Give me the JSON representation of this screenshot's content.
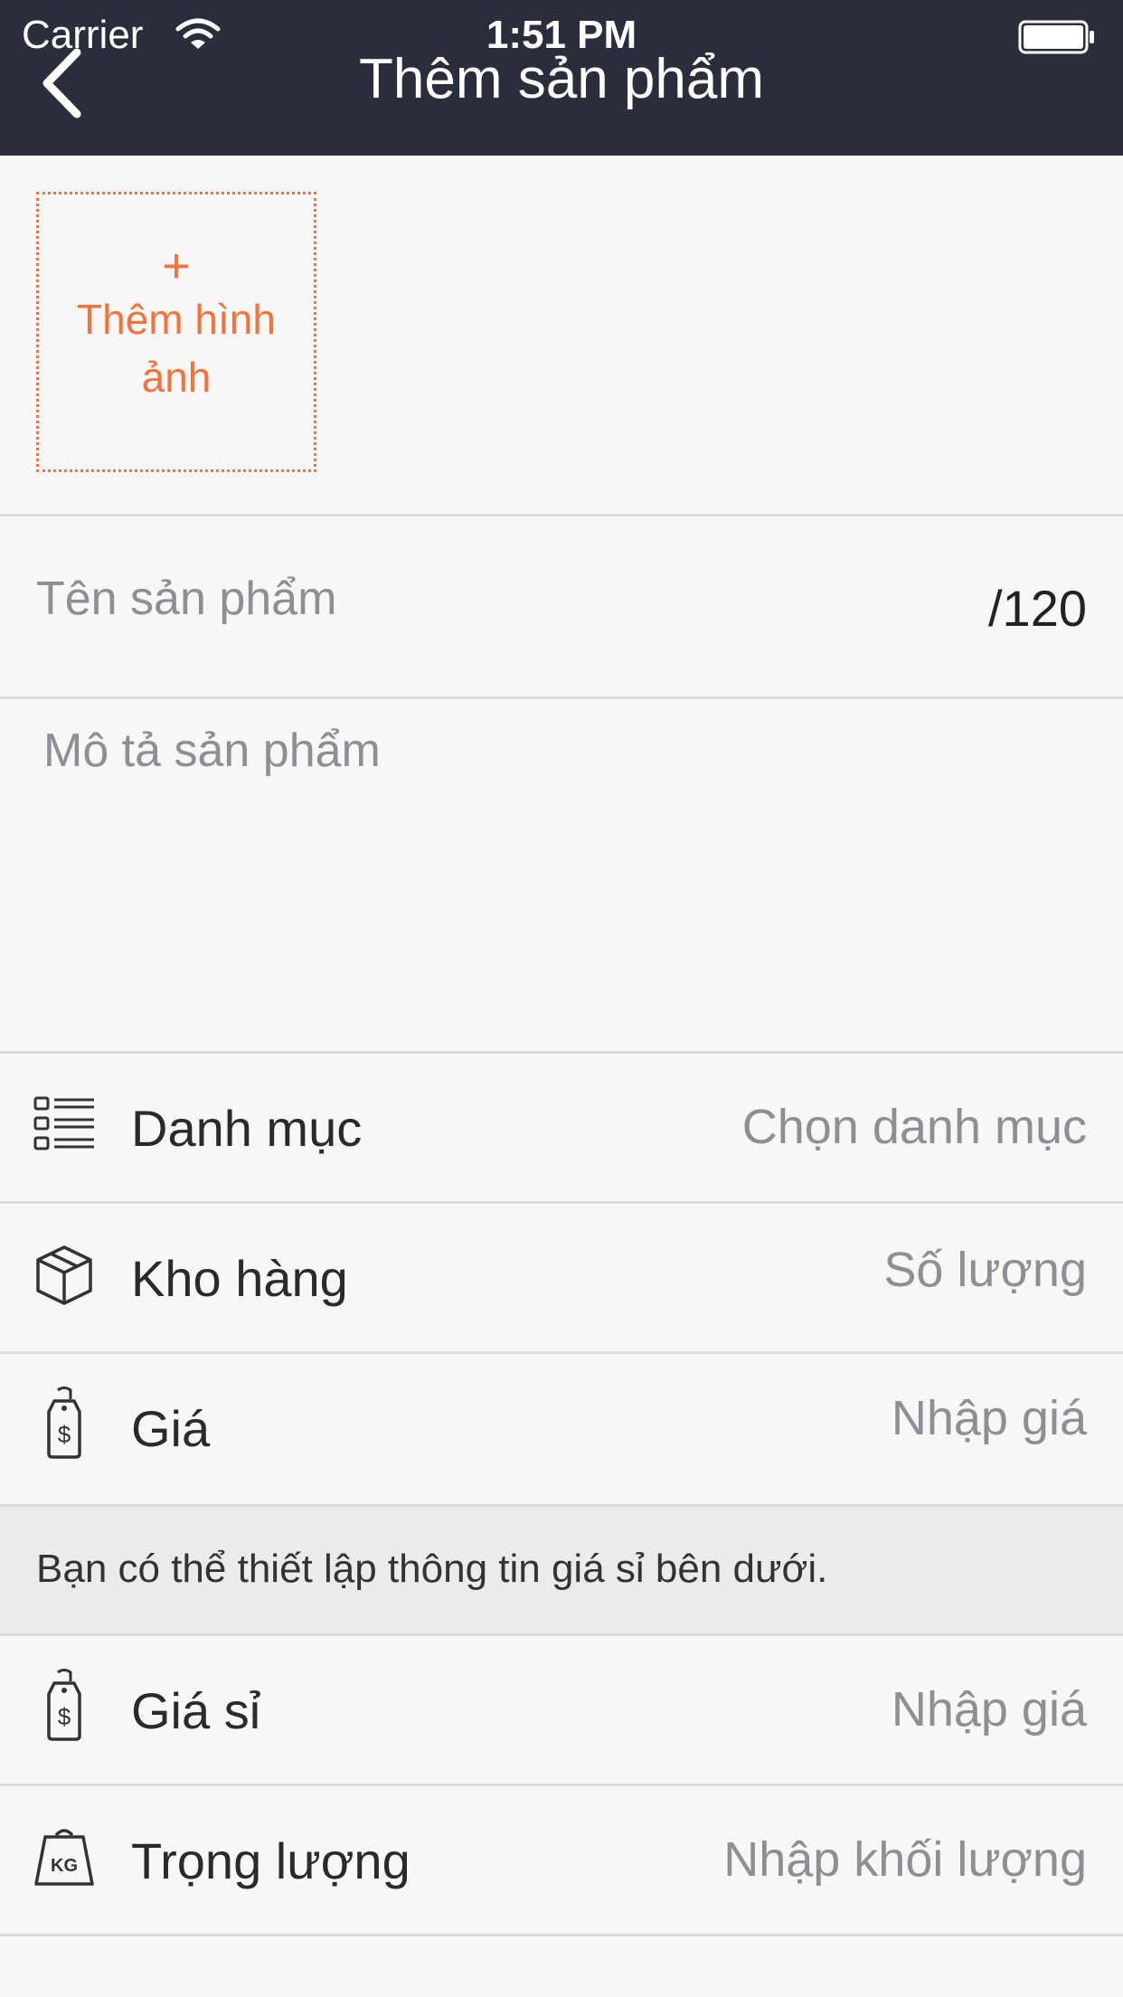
{
  "status_bar": {
    "carrier": "Carrier",
    "time": "1:51 PM"
  },
  "nav": {
    "title": "Thêm sản phẩm",
    "back_icon": "chevron-left-icon"
  },
  "add_image": {
    "plus": "+",
    "label": "Thêm hình ảnh"
  },
  "name_field": {
    "placeholder": "Tên sản phẩm",
    "counter": "/120"
  },
  "description_field": {
    "placeholder": "Mô tả sản phẩm"
  },
  "rows": [
    {
      "icon": "category-list-icon",
      "label": "Danh mục",
      "value": "Chọn danh mục"
    },
    {
      "icon": "box-icon",
      "label": "Kho hàng",
      "value": "Số lượng"
    },
    {
      "icon": "price-tag-icon",
      "label": "Giá",
      "value": "Nhập giá"
    }
  ],
  "wholesale_note": "Bạn có thể thiết lập thông tin giá sỉ bên dưới.",
  "rows2": [
    {
      "icon": "price-tag-icon",
      "label": "Giá sỉ",
      "value": "Nhập giá"
    },
    {
      "icon": "weight-kg-icon",
      "label": "Trọng lượng",
      "value": "Nhập khối lượng"
    }
  ],
  "colors": {
    "nav_bg": "#2b2d3a",
    "accent": "#f4733b",
    "background": "#f7f7f7"
  }
}
